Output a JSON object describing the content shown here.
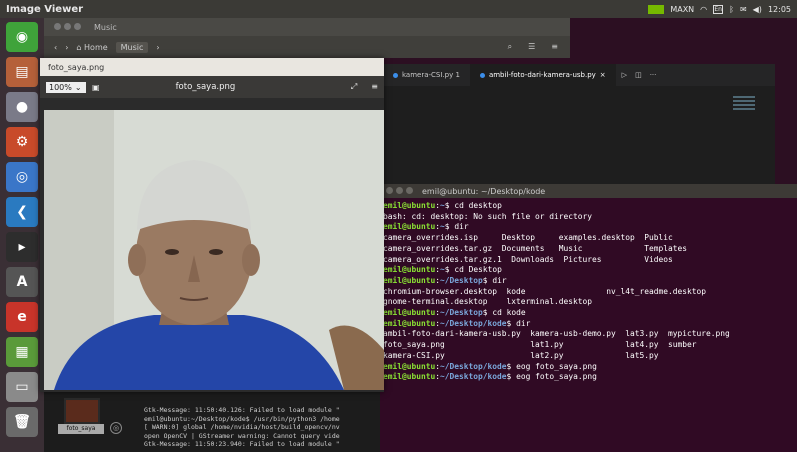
{
  "topbar": {
    "title": "Image Viewer",
    "network_label": "MAXN",
    "clock": "12:05"
  },
  "music_window": {
    "title": "Music",
    "breadcrumb_home": "Home",
    "breadcrumb_current": "Music"
  },
  "vscode": {
    "tabs": [
      {
        "label": "kamera-CSI.py 1"
      },
      {
        "label": "ambil-foto-dari-kamera-usb.py"
      }
    ]
  },
  "terminal": {
    "title": "emil@ubuntu: ~/Desktop/kode",
    "lines": [
      {
        "user": "emil@ubuntu",
        "path": "~",
        "cmd": "cd desktop"
      },
      {
        "text": "bash: cd: desktop: No such file or directory"
      },
      {
        "user": "emil@ubuntu",
        "path": "~",
        "cmd": "dir"
      },
      {
        "text": "camera_overrides.isp     Desktop     examples.desktop  Public"
      },
      {
        "text": "camera_overrides.tar.gz  Documents   Music             Templates"
      },
      {
        "text": "camera_overrides.tar.gz.1  Downloads  Pictures         Videos"
      },
      {
        "user": "emil@ubuntu",
        "path": "~",
        "cmd": "cd Desktop"
      },
      {
        "user": "emil@ubuntu",
        "path": "~/Desktop",
        "cmd": "dir"
      },
      {
        "text": "chromium-browser.desktop  kode                 nv_l4t_readme.desktop"
      },
      {
        "text": "gnome-terminal.desktop    lxterminal.desktop"
      },
      {
        "user": "emil@ubuntu",
        "path": "~/Desktop",
        "cmd": "cd kode"
      },
      {
        "user": "emil@ubuntu",
        "path": "~/Desktop/kode",
        "cmd": "dir"
      },
      {
        "text": "ambil-foto-dari-kamera-usb.py  kamera-usb-demo.py  lat3.py  mypicture.png"
      },
      {
        "text": "foto_saya.png                  lat1.py             lat4.py  sumber"
      },
      {
        "text": "kamera-CSI.py                  lat2.py             lat5.py"
      },
      {
        "user": "emil@ubuntu",
        "path": "~/Desktop/kode",
        "cmd": "eog foto_saya.png"
      },
      {
        "user": "emil@ubuntu",
        "path": "~/Desktop/kode",
        "cmd": "eog foto_saya.png"
      }
    ]
  },
  "viewer": {
    "window_title": "foto_saya.png",
    "zoom": "100%",
    "filename": "foto_saya.png"
  },
  "bottom_terminal": {
    "thumb_label": "foto_saya",
    "lines": [
      "Gtk-Message: 11:50:40.126: Failed to load module \"",
      "emil@ubuntu:~/Desktop/kode$ /usr/bin/python3 /home",
      "[ WARN:0] global /home/nvidia/host/build_opencv/nv",
      "open OpenCV | GStreamer warning: Cannot query vide",
      "Gtk-Message: 11:50:23.940: Failed to load module \""
    ]
  },
  "launcher": [
    {
      "name": "ubuntu-logo-icon",
      "color": "#3fa33a",
      "glyph": "◉"
    },
    {
      "name": "files-icon",
      "color": "#b5603a",
      "glyph": "▤"
    },
    {
      "name": "disk-icon",
      "color": "#7a7a88",
      "glyph": "●"
    },
    {
      "name": "settings-icon",
      "color": "#c84a2a",
      "glyph": "⚙"
    },
    {
      "name": "chromium-icon",
      "color": "#3a76c8",
      "glyph": "◎"
    },
    {
      "name": "vscode-icon",
      "color": "#2a7ac0",
      "glyph": "❮"
    },
    {
      "name": "terminal-icon",
      "color": "#2d2d2d",
      "glyph": "▸"
    },
    {
      "name": "software-icon",
      "color": "#555555",
      "glyph": "A"
    },
    {
      "name": "browser-icon",
      "color": "#c8342a",
      "glyph": "e"
    },
    {
      "name": "image-viewer-icon",
      "color": "#5a9a3a",
      "glyph": "▦"
    },
    {
      "name": "drive-icon",
      "color": "#8a8a8a",
      "glyph": "▭"
    },
    {
      "name": "trash-icon",
      "color": "#6a6a6a",
      "glyph": "🗑"
    }
  ]
}
